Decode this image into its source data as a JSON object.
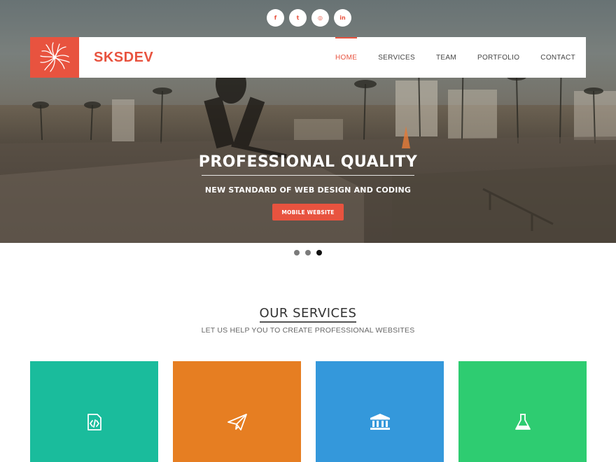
{
  "social": [
    {
      "icon": "facebook-icon",
      "glyph": "f"
    },
    {
      "icon": "twitter-icon",
      "glyph": "t"
    },
    {
      "icon": "dribbble-icon",
      "glyph": "◎"
    },
    {
      "icon": "linkedin-icon",
      "glyph": "in"
    }
  ],
  "nav": {
    "brand": "SKSDEV",
    "logo_icon": "burst-logo-icon",
    "items": [
      {
        "label": "HOME",
        "active": true
      },
      {
        "label": "SERVICES",
        "active": false
      },
      {
        "label": "TEAM",
        "active": false
      },
      {
        "label": "PORTFOLIO",
        "active": false
      },
      {
        "label": "CONTACT",
        "active": false
      }
    ]
  },
  "hero": {
    "title": "PROFESSIONAL QUALITY",
    "subtitle": "NEW STANDARD OF WEB DESIGN AND CODING",
    "button": "MOBILE WEBSITE"
  },
  "slider": {
    "count": 3,
    "active_index": 2
  },
  "services": {
    "title": "OUR SERVICES",
    "subtitle": "LET US HELP YOU TO CREATE PROFESSIONAL WEBSITES",
    "cards": [
      {
        "icon": "code-file-icon",
        "color": "#1abc9c"
      },
      {
        "icon": "paper-plane-icon",
        "color": "#e67e22"
      },
      {
        "icon": "bank-icon",
        "color": "#3498db"
      },
      {
        "icon": "flask-icon",
        "color": "#2ecc71"
      }
    ]
  },
  "colors": {
    "accent": "#e8533f"
  }
}
